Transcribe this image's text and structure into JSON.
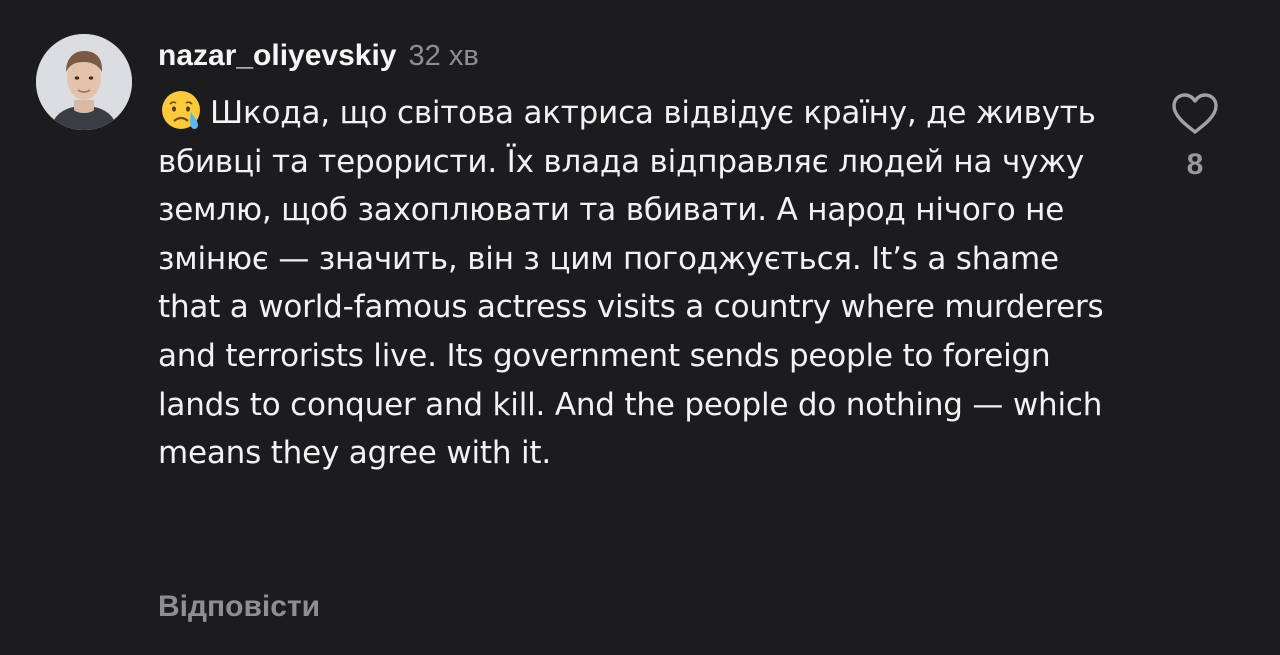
{
  "comment": {
    "username": "nazar_oliyevskiy",
    "time": "32 хв",
    "emoji": "crying-face-emoji",
    "text": "Шкода, що світова актриса відвідує країну, де живуть вбивці та терористи. Їх влада відправляє людей на чужу землю, щоб захоплювати та вбивати. А народ нічого не змінює — значить, він з цим погоджується. It’s a shame that a world-famous actress visits a country where murderers and terrorists live. Its government sends people to foreign lands to conquer and kill. And the people do nothing — which means they agree with it.",
    "likes": "8",
    "reply_label": "Відповісти"
  },
  "colors": {
    "background": "#1c1c1e",
    "text": "#f2f2f5",
    "secondary": "#8e8e93"
  },
  "icons": {
    "like": "heart-outline-icon"
  }
}
